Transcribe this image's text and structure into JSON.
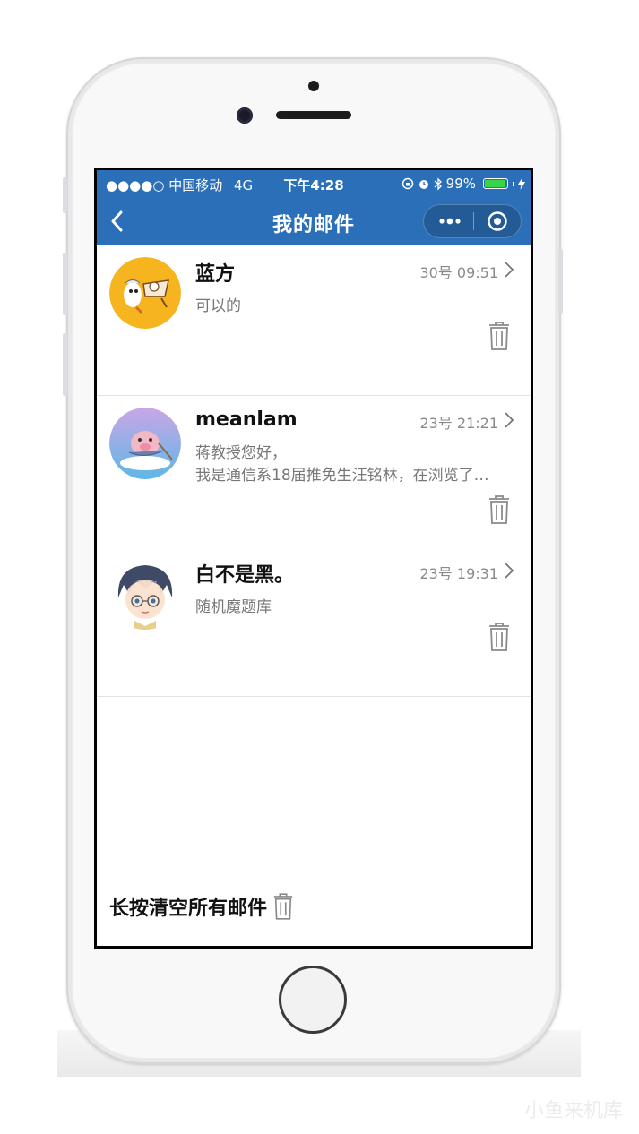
{
  "status_bar": {
    "carrier": "●●●●○ 中国移动",
    "network": "4G",
    "time": "下午4:28",
    "battery_percent": "99%",
    "battery_level": 0.99
  },
  "nav": {
    "title": "我的邮件"
  },
  "mails": [
    {
      "sender": "蓝方",
      "time": "30号 09:51",
      "preview": [
        "可以的"
      ]
    },
    {
      "sender": "meanlam",
      "time": "23号 21:21",
      "preview": [
        "蒋教授您好，",
        "我是通信系18届推免生汪铭林，在浏览了…"
      ]
    },
    {
      "sender": "白不是黑。",
      "time": "23号 19:31",
      "preview": [
        "随机魔题库"
      ]
    }
  ],
  "footer": {
    "clear_all_label": "长按清空所有邮件"
  },
  "watermark": "小鱼来机库",
  "colors": {
    "nav_bg": "#2a6fb8",
    "battery_green": "#38d44a"
  }
}
